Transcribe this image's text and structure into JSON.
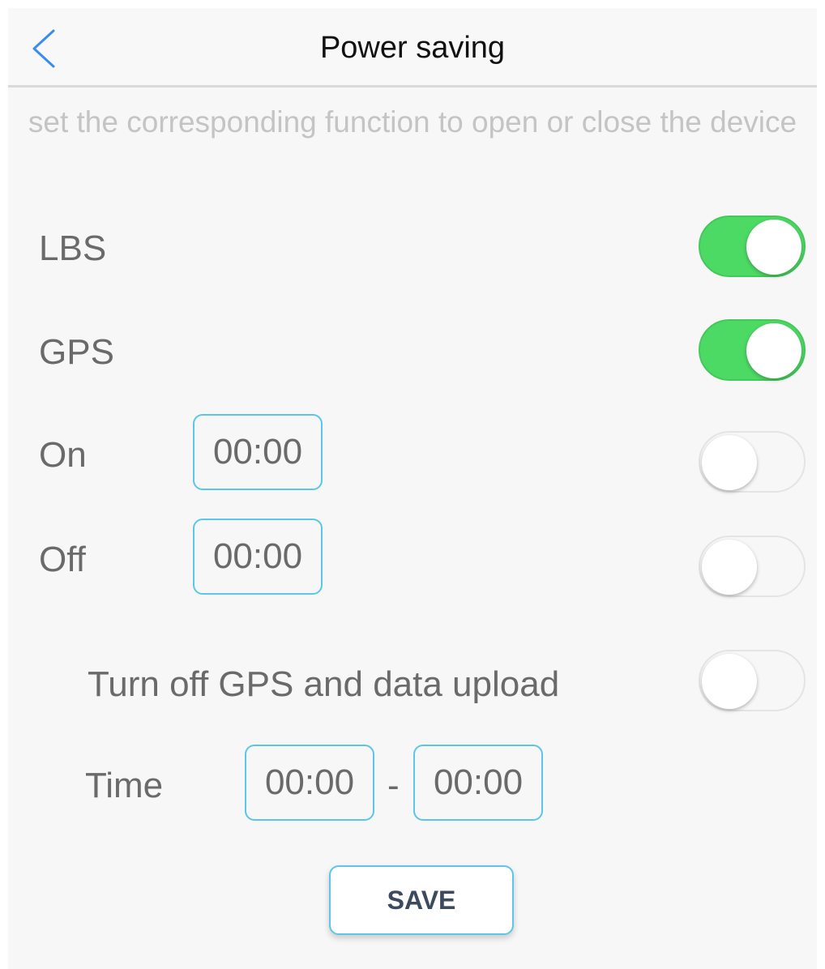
{
  "header": {
    "title": "Power saving",
    "back_icon": "chevron-left-icon"
  },
  "subtitle": "set the corresponding function to open or close the device",
  "settings": {
    "lbs": {
      "label": "LBS",
      "enabled": true
    },
    "gps": {
      "label": "GPS",
      "enabled": true
    },
    "on": {
      "label": "On",
      "time": "00:00",
      "enabled": false
    },
    "off": {
      "label": "Off",
      "time": "00:00",
      "enabled": false
    },
    "gps_upload": {
      "label": "Turn off GPS and data upload",
      "enabled": false
    },
    "time_range": {
      "label": "Time",
      "start": "00:00",
      "separator": "-",
      "end": "00:00"
    }
  },
  "save_label": "SAVE",
  "colors": {
    "toggle_on": "#4cd964",
    "accent_border": "#5bc6e8",
    "back_icon": "#3b8cf0"
  }
}
